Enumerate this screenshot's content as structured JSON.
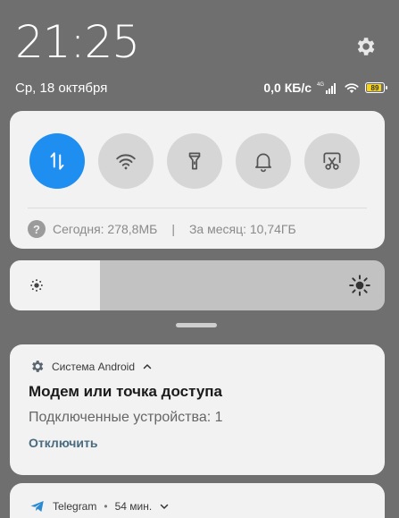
{
  "status_bar": {
    "time": "21:25",
    "date": "Ср, 18 октября",
    "net_speed": "0,0 КБ/с",
    "network_type": "4G",
    "battery_level": "89",
    "battery_fraction": 0.89
  },
  "quick_settings": {
    "tiles": [
      {
        "icon": "mobile-data-icon",
        "active": true
      },
      {
        "icon": "wifi-icon",
        "active": false
      },
      {
        "icon": "flashlight-icon",
        "active": false
      },
      {
        "icon": "bell-icon",
        "active": false
      },
      {
        "icon": "screenshot-icon",
        "active": false
      }
    ],
    "data_usage_today": "Сегодня: 278,8МБ",
    "separator": "|",
    "data_usage_month": "За месяц: 10,74ГБ"
  },
  "brightness": {
    "level_fraction": 0.24
  },
  "notifications": [
    {
      "app": "Система Android",
      "title": "Модем или точка доступа",
      "text": "Подключенные устройства: 1",
      "action": "Отключить"
    },
    {
      "app": "Telegram",
      "separator": "•",
      "time": "54 мин."
    }
  ],
  "colors": {
    "accent": "#1e8ef0",
    "background": "#6f6f6f",
    "card": "#f2f2f2",
    "battery": "#f5d31c"
  }
}
